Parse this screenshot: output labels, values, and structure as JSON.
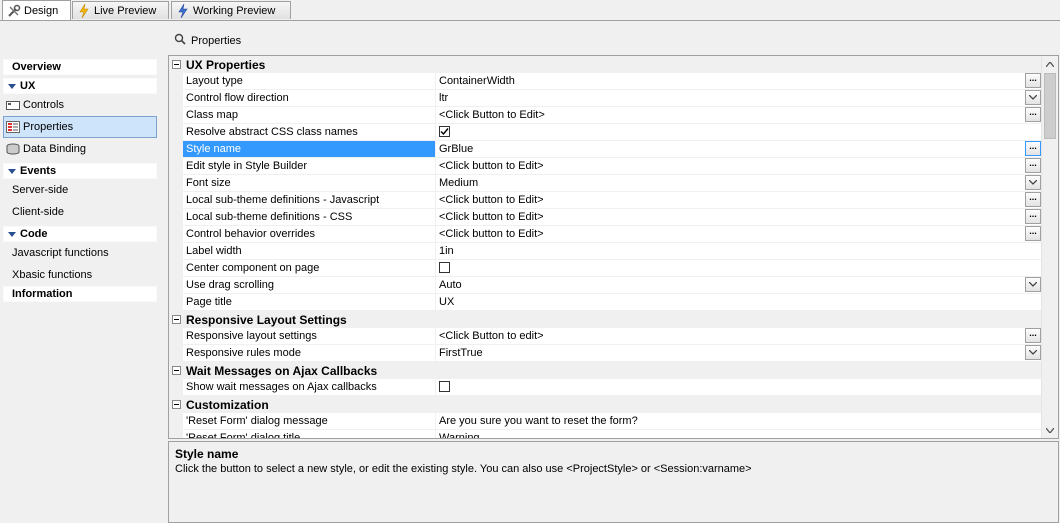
{
  "tabs": [
    {
      "label": "Design",
      "icon": "tools-icon",
      "active": true
    },
    {
      "label": "Live Preview",
      "icon": "lightning-icon",
      "active": false
    },
    {
      "label": "Working Preview",
      "icon": "lightning-blue-icon",
      "active": false
    }
  ],
  "nav": {
    "overview": "Overview",
    "ux": "UX",
    "controls": "Controls",
    "properties": "Properties",
    "data_binding": "Data Binding",
    "events": "Events",
    "server_side": "Server-side",
    "client_side": "Client-side",
    "code": "Code",
    "javascript_functions": "Javascript functions",
    "xbasic_functions": "Xbasic functions",
    "information": "Information"
  },
  "properties_title": "Properties",
  "grid": {
    "ux_properties": "UX Properties",
    "rows": [
      {
        "name": "Layout type",
        "value": "ContainerWidth",
        "control": "ellipsis"
      },
      {
        "name": "Control flow direction",
        "value": "ltr",
        "control": "dropdown"
      },
      {
        "name": "Class map",
        "value": "<Click Button to Edit>",
        "control": "ellipsis"
      },
      {
        "name": "Resolve abstract CSS class names",
        "value": "",
        "control": "checkbox-checked"
      },
      {
        "name": "Style name",
        "value": "GrBlue",
        "control": "ellipsis-focus"
      },
      {
        "name": "Edit style in Style Builder",
        "value": "<Click button to Edit>",
        "control": "ellipsis"
      },
      {
        "name": "Font size",
        "value": "Medium",
        "control": "dropdown"
      },
      {
        "name": "Local sub-theme definitions - Javascript",
        "value": "<Click button to Edit>",
        "control": "ellipsis"
      },
      {
        "name": "Local sub-theme definitions - CSS",
        "value": "<Click button to Edit>",
        "control": "ellipsis"
      },
      {
        "name": "Control behavior overrides",
        "value": "<Click button to Edit>",
        "control": "ellipsis"
      },
      {
        "name": "Label width",
        "value": "1in",
        "control": "none"
      },
      {
        "name": "Center component on page",
        "value": "",
        "control": "checkbox"
      },
      {
        "name": "Use drag scrolling",
        "value": "Auto",
        "control": "dropdown"
      },
      {
        "name": "Page title",
        "value": "UX",
        "control": "none"
      }
    ],
    "responsive_layout": "Responsive Layout Settings",
    "responsive_rows": [
      {
        "name": "Responsive layout settings",
        "value": "<Click Button to edit>",
        "control": "ellipsis"
      },
      {
        "name": "Responsive rules mode",
        "value": "FirstTrue",
        "control": "dropdown"
      }
    ],
    "wait_messages": "Wait Messages on Ajax Callbacks",
    "wait_rows": [
      {
        "name": "Show wait messages on Ajax callbacks",
        "value": "",
        "control": "checkbox"
      }
    ],
    "customization": "Customization",
    "custom_rows": [
      {
        "name": "'Reset Form' dialog message",
        "value": "Are you sure you want to reset the form?",
        "control": "none"
      },
      {
        "name": "'Reset Form' dialog title",
        "value": "Warning",
        "control": "none"
      }
    ]
  },
  "description": {
    "title": "Style name",
    "text": "Click the button to select a new style, or edit the existing style.  You can also use <ProjectStyle> or <Session:varname>"
  },
  "colors": {
    "selection": "#3399ff",
    "panel": "#f0f0f0",
    "nav_selected": "#cde4fb"
  }
}
